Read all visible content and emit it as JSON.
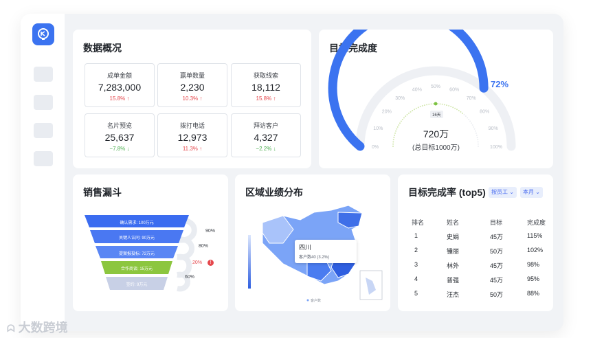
{
  "overview": {
    "title": "数据概况",
    "stats": [
      {
        "label": "成单金额",
        "value": "7,283,000",
        "change": "15.8%",
        "dir": "up"
      },
      {
        "label": "赢单数量",
        "value": "2,230",
        "change": "10.3%",
        "dir": "up"
      },
      {
        "label": "获取线索",
        "value": "18,112",
        "change": "15.8%",
        "dir": "up"
      },
      {
        "label": "名片预览",
        "value": "25,637",
        "change": "−7.8%",
        "dir": "down"
      },
      {
        "label": "拨打电话",
        "value": "12,973",
        "change": "11.3%",
        "dir": "up"
      },
      {
        "label": "拜访客户",
        "value": "4,327",
        "change": "−2.2%",
        "dir": "down"
      }
    ]
  },
  "target": {
    "title": "目标完成度",
    "percent_label": "72%",
    "percent": 0.72,
    "ticks": [
      "0%",
      "10%",
      "20%",
      "30%",
      "40%",
      "50%",
      "60%",
      "70%",
      "80%",
      "90%",
      "100%"
    ],
    "days": "16天",
    "amount": "720万",
    "goal": "(总目标1000万)"
  },
  "funnel": {
    "title": "销售漏斗",
    "stages": [
      {
        "label": "确认需求: 100万元",
        "color": "#3b6cf0"
      },
      {
        "label": "关键人认同: 90万元",
        "color": "#4a78f2"
      },
      {
        "label": "提案报投标: 72万元",
        "color": "#5a86f4"
      },
      {
        "label": "合作商谈: 15万元",
        "color": "#8cc63f"
      },
      {
        "label": "签约: 9万元",
        "color": "#c8d0e6"
      }
    ],
    "rates": [
      {
        "value": "90%",
        "alert": false
      },
      {
        "value": "80%",
        "alert": false
      },
      {
        "value": "20%",
        "alert": true
      },
      {
        "value": "60%",
        "alert": false
      }
    ]
  },
  "region": {
    "title": "区域业绩分布",
    "tooltip_title": "四川",
    "tooltip_text": "客户数40 (3.2%)",
    "legend": "客户数"
  },
  "ranking": {
    "title": "目标完成率 (top5)",
    "filter1": "按员工",
    "filter2": "本月",
    "headers": [
      "排名",
      "姓名",
      "目标",
      "完成度"
    ],
    "rows": [
      [
        "1",
        "史娟",
        "45万",
        "115%"
      ],
      [
        "2",
        "锺丽",
        "50万",
        "102%"
      ],
      [
        "3",
        "林外",
        "45万",
        "98%"
      ],
      [
        "4",
        "普强",
        "45万",
        "95%"
      ],
      [
        "5",
        "汪杰",
        "50万",
        "88%"
      ]
    ]
  },
  "watermark": "大数跨境",
  "colors": {
    "accent": "#3b73f0",
    "up": "#e5484d",
    "down": "#4caf50"
  }
}
